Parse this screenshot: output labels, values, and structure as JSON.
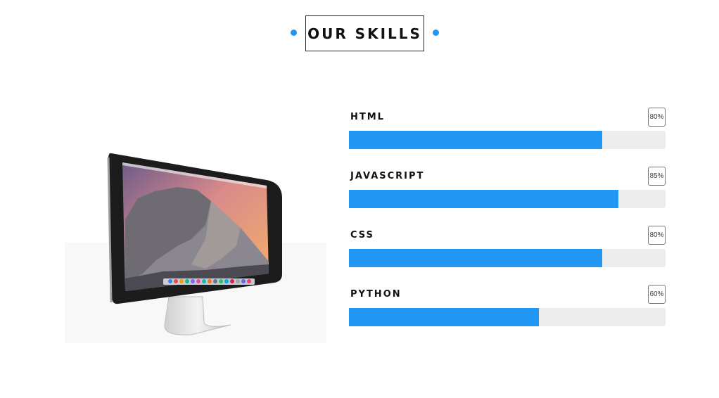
{
  "section": {
    "title": "OUR SKILLS"
  },
  "colors": {
    "accent": "#2196f3",
    "track": "#ececec"
  },
  "image": {
    "icon": "desktop-monitor-image"
  },
  "skills": [
    {
      "label": "HTML",
      "percent_text": "80%",
      "value": 80
    },
    {
      "label": "JAVASCRIPT",
      "percent_text": "85%",
      "value": 85
    },
    {
      "label": "CSS",
      "percent_text": "80%",
      "value": 80
    },
    {
      "label": "PYTHON",
      "percent_text": "60%",
      "value": 60
    }
  ]
}
